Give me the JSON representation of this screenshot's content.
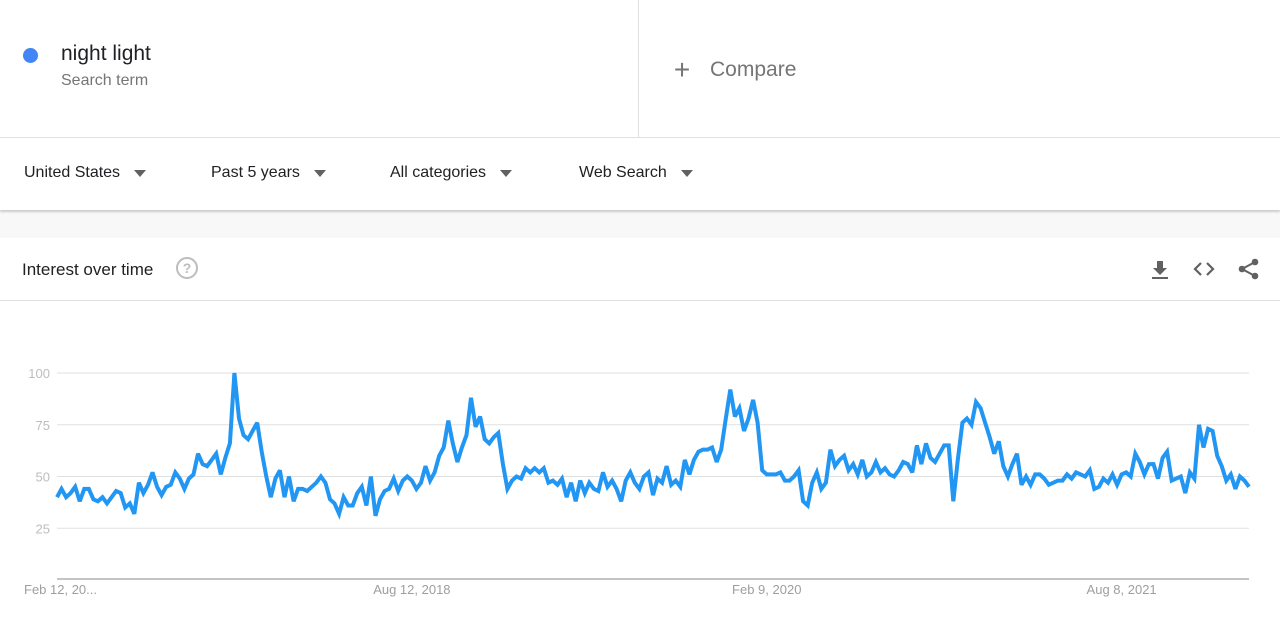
{
  "search_term": {
    "name": "night light",
    "subtitle": "Search term",
    "color": "#4285f4"
  },
  "compare": {
    "icon": "plus-icon",
    "label": "Compare"
  },
  "filters": [
    {
      "label": "United States",
      "icon": "caret-down-icon"
    },
    {
      "label": "Past 5 years",
      "icon": "caret-down-icon"
    },
    {
      "label": "All categories",
      "icon": "caret-down-icon"
    },
    {
      "label": "Web Search",
      "icon": "caret-down-icon"
    }
  ],
  "card": {
    "title": "Interest over time",
    "help_icon": "help-circle-icon",
    "help_glyph": "?",
    "actions": [
      {
        "name": "download-icon"
      },
      {
        "name": "embed-code-icon"
      },
      {
        "name": "share-icon"
      }
    ]
  },
  "chart_data": {
    "type": "line",
    "title": "Interest over time",
    "xlabel": "",
    "ylabel": "",
    "ylim": [
      0,
      100
    ],
    "y_ticks": [
      25,
      50,
      75,
      100
    ],
    "grid": true,
    "line_color": "#2196f3",
    "x_tick_labels": [
      "Feb 12, 20...",
      "Aug 12, 2018",
      "Feb 9, 2020",
      "Aug 8, 2021"
    ],
    "x_tick_index": [
      0,
      78,
      156,
      234
    ],
    "series": [
      {
        "name": "night light",
        "frequency": "weekly",
        "values": [
          40,
          44,
          40,
          42,
          45,
          38,
          44,
          44,
          39,
          38,
          40,
          37,
          40,
          43,
          42,
          35,
          37,
          32,
          47,
          42,
          46,
          52,
          45,
          41,
          45,
          46,
          52,
          49,
          44,
          49,
          51,
          61,
          56,
          55,
          58,
          61,
          51,
          59,
          66,
          100,
          78,
          70,
          68,
          72,
          76,
          62,
          50,
          40,
          49,
          53,
          40,
          50,
          38,
          44,
          44,
          43,
          45,
          47,
          50,
          47,
          39,
          37,
          32,
          40,
          36,
          36,
          42,
          45,
          36,
          50,
          31,
          39,
          43,
          44,
          49,
          43,
          48,
          50,
          48,
          44,
          47,
          55,
          48,
          52,
          60,
          64,
          77,
          66,
          57,
          64,
          70,
          88,
          74,
          79,
          68,
          66,
          69,
          71,
          56,
          44,
          48,
          50,
          49,
          54,
          52,
          54,
          52,
          54,
          47,
          48,
          46,
          49,
          40,
          47,
          38,
          48,
          42,
          47,
          44,
          43,
          52,
          45,
          48,
          44,
          38,
          48,
          52,
          47,
          44,
          50,
          52,
          41,
          49,
          47,
          55,
          46,
          48,
          45,
          58,
          51,
          58,
          62,
          63,
          63,
          64,
          57,
          63,
          78,
          92,
          79,
          83,
          72,
          78,
          87,
          76,
          53,
          51,
          51,
          51,
          52,
          48,
          48,
          50,
          53,
          38,
          36,
          47,
          52,
          44,
          47,
          63,
          55,
          58,
          60,
          53,
          56,
          51,
          58,
          50,
          52,
          57,
          52,
          54,
          51,
          50,
          53,
          57,
          56,
          52,
          65,
          56,
          66,
          59,
          57,
          61,
          65,
          65,
          38,
          58,
          76,
          78,
          75,
          86,
          83,
          76,
          69,
          61,
          67,
          55,
          50,
          56,
          61,
          46,
          50,
          46,
          51,
          51,
          49,
          46,
          47,
          48,
          48,
          51,
          49,
          52,
          51,
          50,
          53,
          44,
          45,
          49,
          47,
          51,
          46,
          51,
          52,
          50,
          61,
          57,
          51,
          56,
          56,
          49,
          59,
          62,
          48,
          49,
          50,
          42,
          52,
          49,
          75,
          64,
          73,
          72,
          60,
          55,
          48,
          51,
          44,
          50,
          48,
          45
        ]
      }
    ]
  }
}
